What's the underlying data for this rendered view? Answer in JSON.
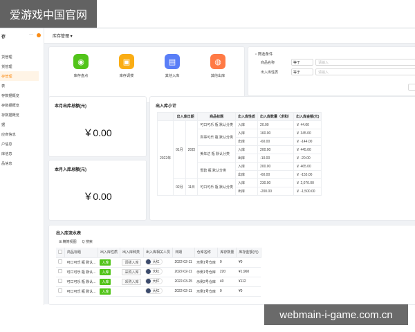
{
  "watermark": {
    "top": "爱游戏中国官网",
    "bottom": "webmain-i-game.com.cn"
  },
  "sidebar": {
    "title": "存",
    "menu_dots": "···",
    "items": [
      {
        "label": "货管理",
        "active": false
      },
      {
        "label": "货管理",
        "active": false
      },
      {
        "label": "存管理",
        "active": true
      },
      {
        "label": "表",
        "active": false
      },
      {
        "label": "存数据概览",
        "active": false
      },
      {
        "label": "存数据概览",
        "active": false
      },
      {
        "label": "存数据概览",
        "active": false
      },
      {
        "label": "据",
        "active": false
      },
      {
        "label": "应商信息",
        "active": false
      },
      {
        "label": "户信息",
        "active": false
      },
      {
        "label": "库信息",
        "active": false
      },
      {
        "label": "品信息",
        "active": false
      }
    ]
  },
  "topbar": {
    "title": "库存管理 ▾"
  },
  "quick_actions": [
    {
      "label": "库存盘点",
      "icon": "inventory-check-icon",
      "color": "#52c41a",
      "glyph": "◉"
    },
    {
      "label": "库存调拨",
      "icon": "truck-icon",
      "color": "#faad14",
      "glyph": "▣"
    },
    {
      "label": "其他入库",
      "icon": "inbound-box-icon",
      "color": "#597ef7",
      "glyph": "▤"
    },
    {
      "label": "其他出库",
      "icon": "outbound-bulb-icon",
      "color": "#ff7a45",
      "glyph": "◍"
    }
  ],
  "filter": {
    "title": "筛选条件",
    "rows": [
      {
        "name": "商品名称",
        "operator": "等于",
        "placeholder": "请输入"
      },
      {
        "name": "出入库性质",
        "operator": "等于",
        "placeholder": "请输入"
      }
    ]
  },
  "stats": [
    {
      "title": "本月出库总额(元)",
      "value": "￥0.00"
    },
    {
      "title": "本月入库总额(元)",
      "value": "￥0.00"
    }
  ],
  "pivot": {
    "title": "出入库小计",
    "headers": [
      "出入库日期",
      "商品标题",
      "出入库性质",
      "出入库数量（求和）",
      "出入库金额(元)"
    ],
    "year": "2022年",
    "rows": [
      {
        "month": "01月",
        "day": "20日",
        "product": "可口可乐 瓶 默认分类",
        "nature": "入库",
        "qty": "20.00",
        "amount": "￥ 44.00"
      },
      {
        "month": "",
        "day": "",
        "product": "百事可乐 瓶 默认分类",
        "nature": "入库",
        "qty": "160.00",
        "amount": "￥ 345.00"
      },
      {
        "month": "",
        "day": "",
        "product": "",
        "nature": "出库",
        "qty": "-60.00",
        "amount": "￥ -144.00"
      },
      {
        "month": "",
        "day": "",
        "product": "美年达 瓶 默认分类",
        "nature": "入库",
        "qty": "200.00",
        "amount": "￥ 445.00"
      },
      {
        "month": "",
        "day": "",
        "product": "",
        "nature": "出库",
        "qty": "-10.00",
        "amount": "￥ -20.00"
      },
      {
        "month": "",
        "day": "",
        "product": "雪碧 瓶 默认分类",
        "nature": "入库",
        "qty": "200.00",
        "amount": "￥ 465.00"
      },
      {
        "month": "",
        "day": "",
        "product": "",
        "nature": "出库",
        "qty": "-60.00",
        "amount": "￥ -155.00"
      },
      {
        "month": "02月",
        "day": "11日",
        "product": "可口可乐 瓶 默认分类",
        "nature": "入库",
        "qty": "230.00",
        "amount": "￥ 2,070.00"
      },
      {
        "month": "",
        "day": "",
        "product": "",
        "nature": "出库",
        "qty": "-200.00",
        "amount": "￥ -1,500.00"
      }
    ]
  },
  "flow_table": {
    "title": "出入库流水表",
    "tools": [
      "⊞ 精简视图",
      "Q 搜索"
    ],
    "headers": [
      "商品标题",
      "出入库性质",
      "出入库种类",
      "出入库相关人员",
      "日期",
      "仓库名称",
      "库存数量",
      "库存金额(元)"
    ],
    "rows": [
      {
        "product": "可口可乐 瓶 默认...",
        "nature": "入库",
        "kind": "调拨入库",
        "person": "大红",
        "date": "2022-02-11",
        "warehouse": "示例1号仓库",
        "qty": "0",
        "amount": "¥0"
      },
      {
        "product": "可口可乐 瓶 默认...",
        "nature": "入库",
        "kind": "采购入库",
        "person": "大红",
        "date": "2022-02-11",
        "warehouse": "示例1号仓库",
        "qty": "220",
        "amount": "¥1,960"
      },
      {
        "product": "可口可乐 瓶 默认...",
        "nature": "入库",
        "kind": "采购入库",
        "person": "大红",
        "date": "2022-03-25",
        "warehouse": "示例2号仓库",
        "qty": "40",
        "amount": "¥112"
      },
      {
        "product": "可口可乐 瓶 默认...",
        "nature": "入库",
        "kind": "",
        "person": "大红",
        "date": "2022-02-11",
        "warehouse": "示例1号仓库",
        "qty": "0",
        "amount": "¥0"
      }
    ]
  }
}
